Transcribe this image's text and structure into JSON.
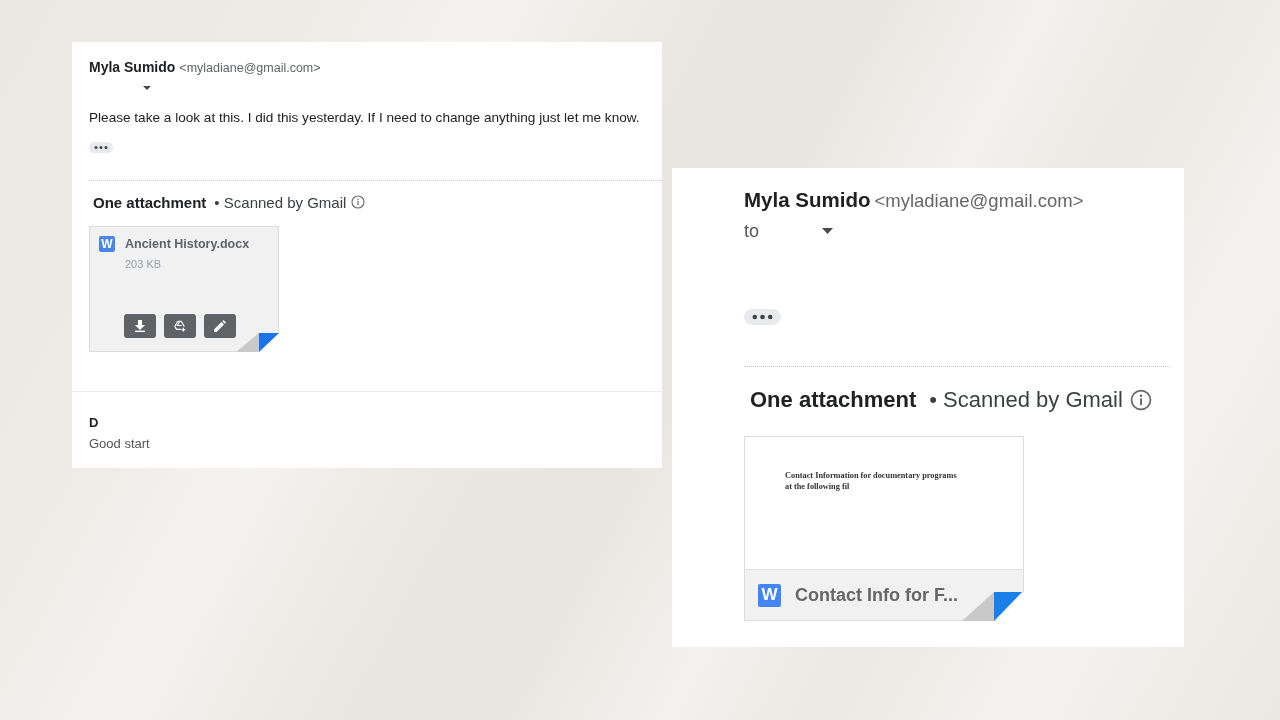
{
  "panels": [
    {
      "sender": {
        "name": "Myla Sumido",
        "email": "<myladiane@gmail.com>"
      },
      "body": "Please take a look at this. I did this yesterday. If I need to change anything just let me know.",
      "attachments_title": "One attachment",
      "scan_note": "• Scanned by Gmail",
      "attachment": {
        "kind": "file",
        "badge": "W",
        "name": "Ancient History.docx",
        "size": "203 KB"
      },
      "reply": {
        "sender": "D",
        "snippet": "Good start"
      }
    },
    {
      "sender": {
        "name": "Myla Sumido",
        "email": "<myladiane@gmail.com>"
      },
      "recipient_prefix": "to",
      "attachments_title": "One attachment",
      "scan_note": "• Scanned by Gmail",
      "attachment": {
        "kind": "preview",
        "badge": "W",
        "name": "Contact Info for F...",
        "preview_lines": [
          "Contact Information for documentary programs",
          "at the following fil"
        ]
      }
    }
  ]
}
